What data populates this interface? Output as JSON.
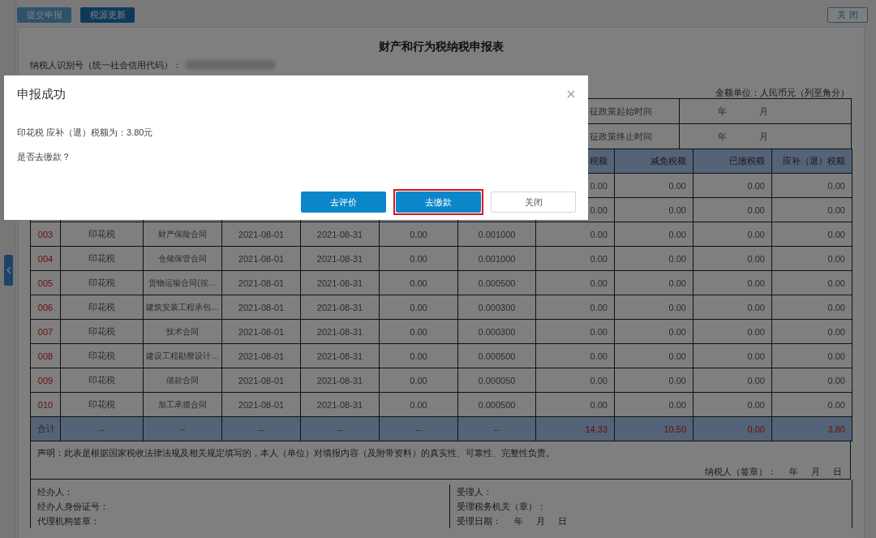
{
  "toolbar": {
    "buttons": [
      {
        "label": "提交申报",
        "kind": "light"
      },
      {
        "label": "税源更新",
        "kind": "dark"
      }
    ],
    "close_label": "关闭"
  },
  "form": {
    "title": "财产和行为税纳税申报表",
    "taxpayer_id_label": "纳税人识别号（统一社会信用代码）：",
    "amount_unit": "金额单位：人民币元（列至角分）",
    "policy_rows": [
      {
        "label": "征政策起始时间",
        "year": "年",
        "month": "月"
      },
      {
        "label": "征政策终止时间",
        "year": "年",
        "month": "月"
      }
    ],
    "table": {
      "columns": [
        "税额",
        "减免税额",
        "已缴税额",
        "应补（退）税额"
      ],
      "rows": [
        {
          "kind": "item",
          "cells": [
            "0.00",
            "0.00",
            "0.00",
            "0.00"
          ]
        },
        {
          "kind": "item",
          "cells": [
            "0.00",
            "0.00",
            "0.00",
            "0.00"
          ]
        },
        {
          "kind": "item",
          "cells": [
            "003",
            "印花税",
            "财产保险合同",
            "2021-08-01",
            "2021-08-31",
            "0.00",
            "0.001000",
            "0.00",
            "0.00",
            "0.00",
            "0.00"
          ]
        },
        {
          "kind": "item",
          "cells": [
            "004",
            "印花税",
            "仓储保管合同",
            "2021-08-01",
            "2021-08-31",
            "0.00",
            "0.001000",
            "0.00",
            "0.00",
            "0.00",
            "0.00"
          ]
        },
        {
          "kind": "item",
          "cells": [
            "005",
            "印花税",
            "货物运输合同(按…",
            "2021-08-01",
            "2021-08-31",
            "0.00",
            "0.000500",
            "0.00",
            "0.00",
            "0.00",
            "0.00"
          ]
        },
        {
          "kind": "item",
          "cells": [
            "006",
            "印花税",
            "建筑安装工程承包…",
            "2021-08-01",
            "2021-08-31",
            "0.00",
            "0.000300",
            "0.00",
            "0.00",
            "0.00",
            "0.00"
          ]
        },
        {
          "kind": "item",
          "cells": [
            "007",
            "印花税",
            "技术合同",
            "2021-08-01",
            "2021-08-31",
            "0.00",
            "0.000300",
            "0.00",
            "0.00",
            "0.00",
            "0.00"
          ]
        },
        {
          "kind": "item",
          "cells": [
            "008",
            "印花税",
            "建设工程勘察设计…",
            "2021-08-01",
            "2021-08-31",
            "0.00",
            "0.000500",
            "0.00",
            "0.00",
            "0.00",
            "0.00"
          ]
        },
        {
          "kind": "item",
          "cells": [
            "009",
            "印花税",
            "借款合同",
            "2021-08-01",
            "2021-08-31",
            "0.00",
            "0.000050",
            "0.00",
            "0.00",
            "0.00",
            "0.00"
          ]
        },
        {
          "kind": "item",
          "cells": [
            "010",
            "印花税",
            "加工承揽合同",
            "2021-08-01",
            "2021-08-31",
            "0.00",
            "0.000500",
            "0.00",
            "0.00",
            "0.00",
            "0.00"
          ]
        },
        {
          "kind": "total",
          "cells": [
            "合计",
            "--",
            "--",
            "--",
            "--",
            "--",
            "--",
            "14.33",
            "10.50",
            "0.00",
            "3.80"
          ]
        }
      ]
    },
    "declaration": "声明：此表是根据国家税收法律法规及相关规定填写的，本人（单位）对填报内容（及附带资料）的真实性、可靠性、完整性负责。",
    "signature": {
      "label": "纳税人（签章）：",
      "date_parts": [
        "年",
        "月",
        "日"
      ]
    },
    "footer": {
      "left": [
        {
          "label": "经办人："
        },
        {
          "label": "经办人身份证号："
        },
        {
          "label": "代理机构签章："
        }
      ],
      "right": [
        {
          "label": "受理人："
        },
        {
          "label": "受理税务机关（章）："
        },
        {
          "label": "受理日期：",
          "date_parts": [
            "年",
            "月",
            "日"
          ]
        }
      ]
    }
  },
  "modal": {
    "title": "申报成功",
    "message": "印花税 应补（退）税额为：3.80元",
    "question": "是否去缴款？",
    "buttons": [
      {
        "label": "去评价",
        "kind": "primary",
        "highlighted": false
      },
      {
        "label": "去缴款",
        "kind": "primary",
        "highlighted": true
      },
      {
        "label": "关闭",
        "kind": "default",
        "highlighted": false
      }
    ]
  }
}
